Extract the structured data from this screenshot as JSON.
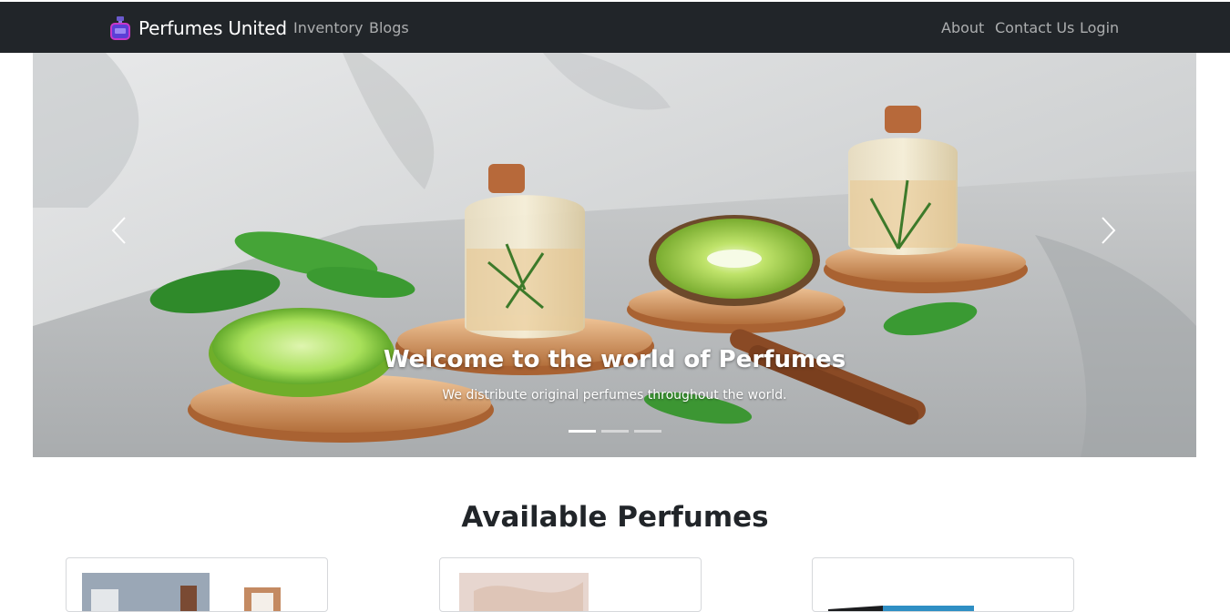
{
  "navbar": {
    "brand_name": "Perfumes United",
    "brand_icon": "perfume-bottle-icon",
    "left_links": [
      "Inventory",
      "Blogs"
    ],
    "right_links": [
      "About",
      "Contact Us",
      "Login"
    ]
  },
  "carousel": {
    "caption_title": "Welcome to the world of Perfumes",
    "caption_text": "We distribute original perfumes throughout the world.",
    "prev_icon": "chevron-left-icon",
    "next_icon": "chevron-right-icon",
    "slides": 3,
    "active_slide": 1
  },
  "products": {
    "heading": "Available Perfumes"
  },
  "colors": {
    "navbar_bg": "#212529",
    "nav_link": "rgba(255,255,255,0.62)",
    "heading": "#212529"
  }
}
